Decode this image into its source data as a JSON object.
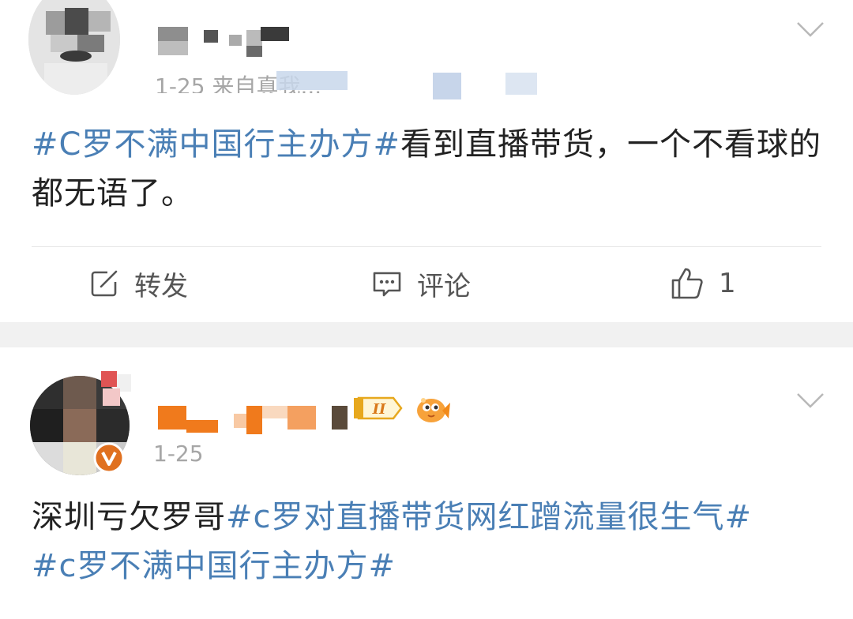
{
  "post1": {
    "meta_text": "1-25 来自真我...",
    "content_topic": "#C罗不满中国行主办方#",
    "content_text": "看到直播带货，一个不看球的都无语了。",
    "actions": {
      "repost_label": "转发",
      "comment_label": "评论",
      "like_count": "1"
    }
  },
  "post2": {
    "date": "1-25",
    "level_badge": "II",
    "content_prefix": "深圳亏欠罗哥",
    "content_topic1": "#c罗对直播带货网红蹭流量很生气#",
    "content_topic2": "#c罗不满中国行主办方#"
  },
  "colors": {
    "topic_link": "#4a7fb5",
    "meta_gray": "#a6a6a6",
    "separator": "#f1f1f1",
    "verified_badge": "#e0701f",
    "username_orange": "#f07a1c"
  },
  "icons": [
    "chevron-down-icon",
    "repost-icon",
    "comment-icon",
    "like-icon",
    "verified-badge-icon",
    "level-badge-icon",
    "fish-emoji-icon"
  ]
}
